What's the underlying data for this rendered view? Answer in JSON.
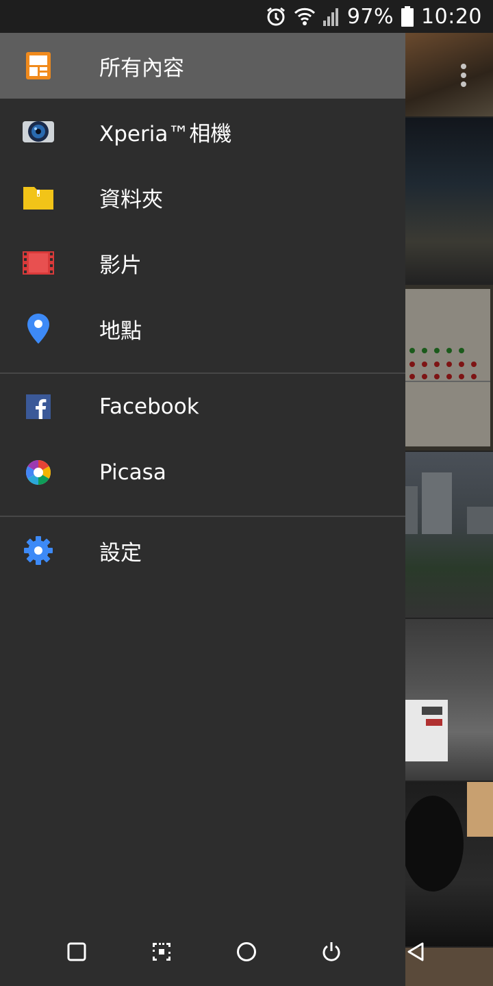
{
  "status_bar": {
    "battery_percent": "97%",
    "time": "10:20",
    "icons": [
      "alarm-icon",
      "wifi-icon",
      "signal-icon",
      "battery-icon"
    ]
  },
  "drawer": {
    "primary_items": [
      {
        "label": "所有內容",
        "icon": "all-content-icon",
        "selected": true
      },
      {
        "label": "Xperia™相機",
        "icon": "camera-icon",
        "selected": false
      },
      {
        "label": "資料夾",
        "icon": "folder-icon",
        "selected": false
      },
      {
        "label": "影片",
        "icon": "film-icon",
        "selected": false
      },
      {
        "label": "地點",
        "icon": "location-pin-icon",
        "selected": false
      }
    ],
    "service_items": [
      {
        "label": "Facebook",
        "icon": "facebook-icon"
      },
      {
        "label": "Picasa",
        "icon": "picasa-icon"
      }
    ],
    "settings_item": {
      "label": "設定",
      "icon": "gear-icon"
    }
  },
  "nav_bar": {
    "buttons": [
      "recents-icon",
      "screenshot-icon",
      "home-icon",
      "power-icon",
      "back-icon"
    ]
  },
  "colors": {
    "drawer_bg": "#2d2d2d",
    "selected_bg": "#5e5e5e",
    "status_bar_bg": "#1e1e1e"
  }
}
